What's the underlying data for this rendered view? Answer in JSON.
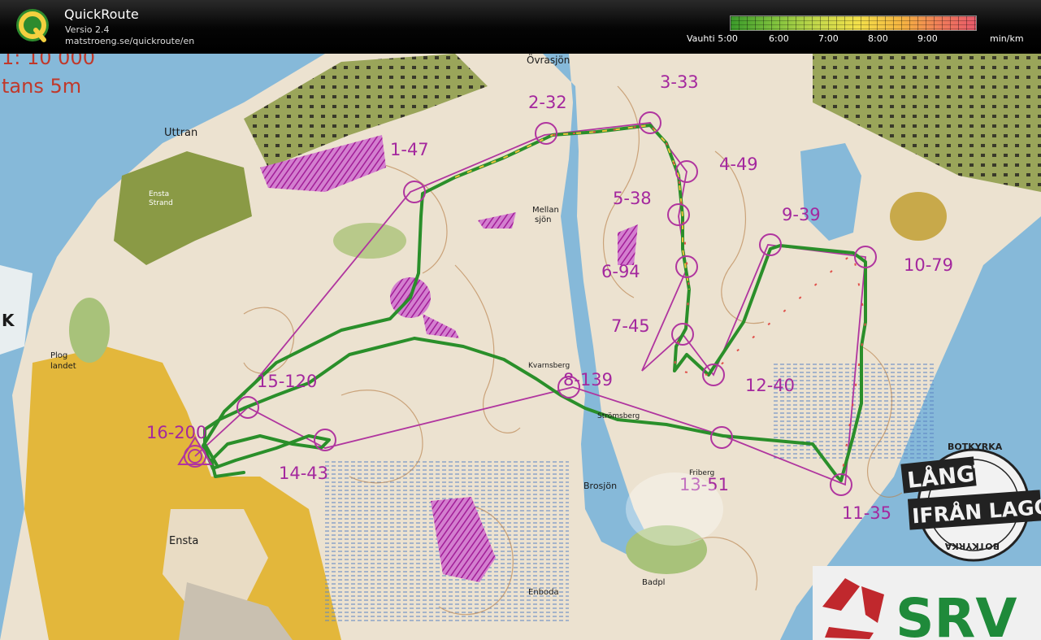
{
  "header": {
    "title": "QuickRoute",
    "version": "Versio 2.4",
    "url": "matstroeng.se/quickroute/en",
    "logo_letter": "Q"
  },
  "pace_scale": {
    "prefix": "Vauhti 5:00",
    "ticks": [
      "6:00",
      "7:00",
      "8:00",
      "9:00"
    ],
    "unit": "min/km"
  },
  "map": {
    "scale_text": "1: 10 000",
    "contour_text": "tans  5m",
    "place_names": {
      "uttran": "Uttran",
      "ovrasjon": "Övrasjön",
      "mellansjon_1": "Mellan",
      "mellansjon_2": "sjön",
      "ensta_strand_1": "Ensta",
      "ensta_strand_2": "Strand",
      "plog_1": "Plog",
      "plog_2": "landet",
      "ensta": "Ensta",
      "brosjon": "Brosjön",
      "badpl": "Badpl",
      "enboda": "Enboda",
      "stromsberg": "Strömsberg",
      "kvarnsberg": "Kvarnsberg",
      "frisberg": "Friberg",
      "legend_k": "K"
    },
    "controls": [
      {
        "label": "1-47"
      },
      {
        "label": "2-32"
      },
      {
        "label": "3-33"
      },
      {
        "label": "4-49"
      },
      {
        "label": "5-38"
      },
      {
        "label": "6-94"
      },
      {
        "label": "7-45"
      },
      {
        "label": "8-139"
      },
      {
        "label": "9-39"
      },
      {
        "label": "10-79"
      },
      {
        "label": "11-35"
      },
      {
        "label": "12-40"
      },
      {
        "label": "13-51"
      },
      {
        "label": "14-43"
      },
      {
        "label": "15-120"
      },
      {
        "label": "16-200"
      }
    ],
    "sponsor": {
      "badge_top": "BOTKYRKA",
      "line1": "LÅNGT",
      "line2": "IFRÅN LAGOM",
      "badge_bottom": "BOTKYRKA",
      "srv": "SRV"
    },
    "colors": {
      "paper": "#ede4d3",
      "forest_green": "#8fa04a",
      "water": "#7fb6d6",
      "open_yellow": "#e5b83a",
      "purple": "#b0359f",
      "route_green": "#2a8f2a"
    }
  }
}
